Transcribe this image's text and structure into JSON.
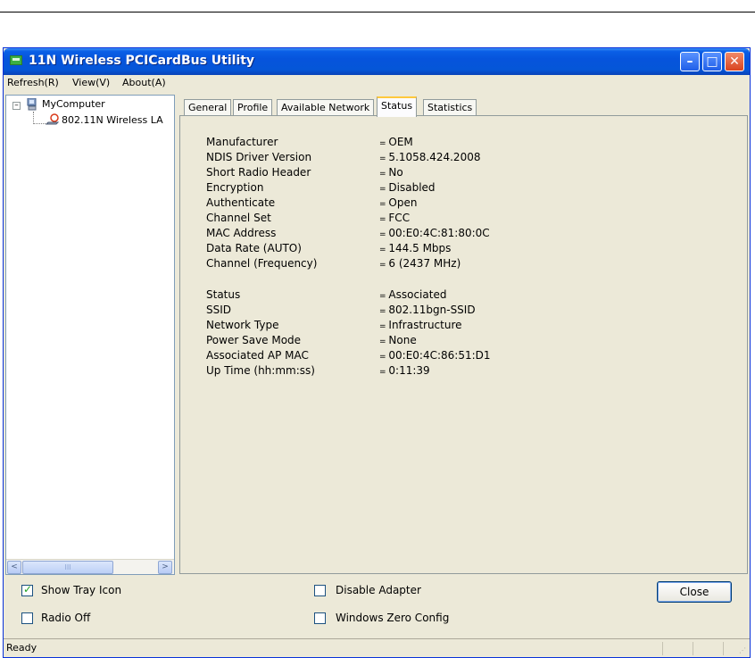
{
  "window": {
    "title": "11N Wireless PCICardBus Utility",
    "buttons": {
      "minimize": "–",
      "maximize": "□",
      "close": "✕"
    }
  },
  "menu": {
    "refresh": "Refresh(R)",
    "view": "View(V)",
    "about": "About(A)"
  },
  "tree": {
    "root": "MyComputer",
    "expand_symbol": "–",
    "child": "802.11N Wireless LA"
  },
  "scroll": {
    "left": "<",
    "right": ">",
    "thumb": "III"
  },
  "tabs": [
    "General",
    "Profile",
    "Available Network",
    "Status",
    "Statistics"
  ],
  "active_tab": "Status",
  "status_info": {
    "section1": [
      {
        "label": "Manufacturer",
        "value": "OEM"
      },
      {
        "label": "NDIS Driver Version",
        "value": "5.1058.424.2008"
      },
      {
        "label": "Short Radio Header",
        "value": "No"
      },
      {
        "label": "Encryption",
        "value": "Disabled"
      },
      {
        "label": "Authenticate",
        "value": "Open"
      },
      {
        "label": "Channel Set",
        "value": "FCC"
      },
      {
        "label": "MAC Address",
        "value": "00:E0:4C:81:80:0C"
      },
      {
        "label": "Data Rate (AUTO)",
        "value": "144.5 Mbps"
      },
      {
        "label": "Channel (Frequency)",
        "value": "6 (2437 MHz)"
      }
    ],
    "section2": [
      {
        "label": "Status",
        "value": "Associated"
      },
      {
        "label": "SSID",
        "value": "802.11bgn-SSID"
      },
      {
        "label": "Network Type",
        "value": "Infrastructure"
      },
      {
        "label": "Power Save Mode",
        "value": "None"
      },
      {
        "label": "Associated AP MAC",
        "value": "00:E0:4C:86:51:D1"
      },
      {
        "label": "Up Time (hh:mm:ss)",
        "value": "0:11:39"
      }
    ]
  },
  "options": {
    "show_tray_icon": {
      "label": "Show Tray Icon",
      "checked": true
    },
    "radio_off": {
      "label": "Radio Off",
      "checked": false
    },
    "disable_adapter": {
      "label": "Disable Adapter",
      "checked": false
    },
    "windows_zero_config": {
      "label": "Windows Zero Config",
      "checked": false
    }
  },
  "close_button": "Close",
  "statusbar": {
    "text": "Ready"
  },
  "colors": {
    "title_blue": "#0654dc",
    "close_red": "#d9431f",
    "panel_bg": "#ece9d8"
  }
}
